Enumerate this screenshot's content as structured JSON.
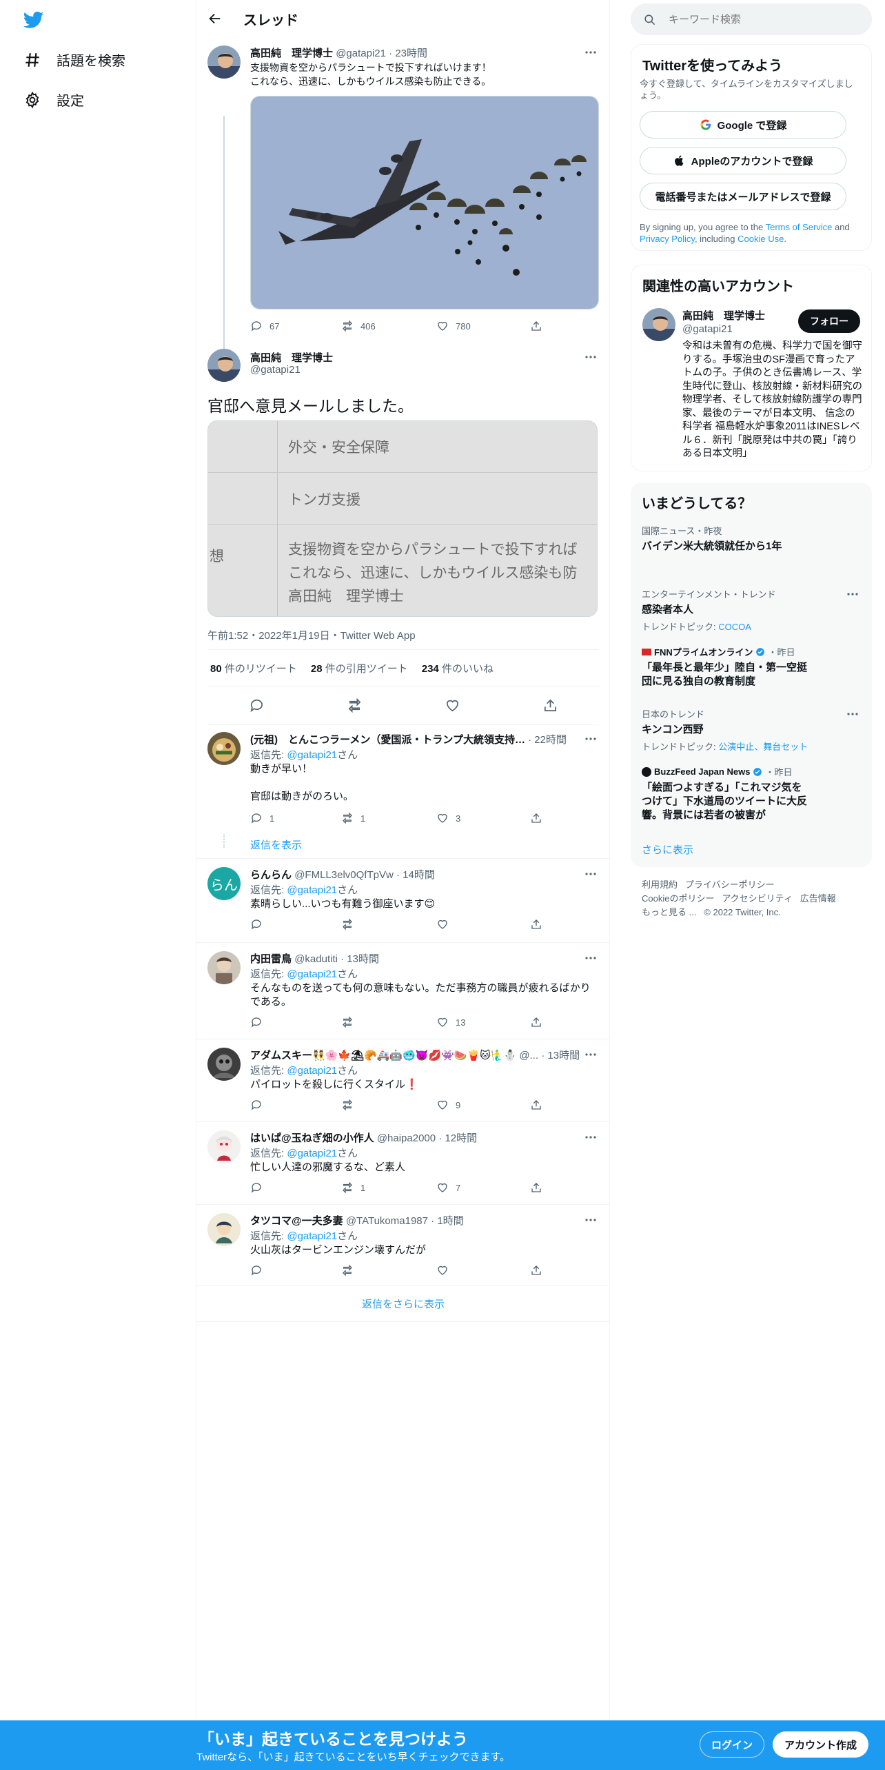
{
  "colors": {
    "accent": "#1d9bf0",
    "text": "#0f1419",
    "muted": "#536471",
    "border": "#eff3f4"
  },
  "nav": {
    "explore": "話題を検索",
    "settings": "設定"
  },
  "header": {
    "title": "スレッド"
  },
  "tweet1": {
    "name": "高田純　理学博士",
    "handle": "@gatapi21",
    "time": "23時間",
    "line1": "支援物資を空からパラシュートで投下すればいけます！",
    "line2": "これなら、迅速に、しかもウイルス感染も防止できる。",
    "replies": "67",
    "retweets": "406",
    "likes": "780"
  },
  "tweet2": {
    "name": "高田純　理学博士",
    "handle": "@gatapi21",
    "text": "官邸へ意見メールしました。",
    "media": {
      "row1": "外交・安全保障",
      "row2": "トンガ支援",
      "row3_label": "想",
      "row3_line1": "支援物資を空からパラシュートで投下すれば",
      "row3_line2": "これなら、迅速に、しかもウイルス感染も防",
      "row3_line3": "高田純　理学博士"
    },
    "timestamp": "午前1:52・2022年1月19日・Twitter Web App",
    "stats": {
      "retweets_count": "80",
      "retweets_label": "件のリツイート",
      "quotes_count": "28",
      "quotes_label": "件の引用ツイート",
      "likes_count": "234",
      "likes_label": "件のいいね"
    }
  },
  "reply_prefix": "返信先: ",
  "reply_to": "@gatapi21",
  "reply_suffix": "さん",
  "replies": [
    {
      "name": "(元祖)　とんこつラーメン（愛国派・トランプ大統領支持…",
      "handle": "",
      "time": "22時間",
      "line1": "動きが早い！",
      "line2": "官邸は動きがのろい。",
      "reply_count": "1",
      "retweet_count": "1",
      "like_count": "3",
      "show_replies": "返信を表示"
    },
    {
      "name": "らんらん",
      "handle": "@FMLL3elv0QfTpVw",
      "time": "14時間",
      "line1": "素晴らしい...いつも有難う御座います😊",
      "avatar_text": "らん"
    },
    {
      "name": "内田雷鳥",
      "handle": "@kadutiti",
      "time": "13時間",
      "line1": "そんなものを送っても何の意味もない。ただ事務方の職員が疲れるばかり",
      "line2": "である。",
      "like_count": "13"
    },
    {
      "name": "アダムスキー👯🌸🍁⛱🥐🚑🤖🥶👿💋👾🍉🍟🐱🧜‍♂️⛄",
      "handle": "@...",
      "time": "13時間",
      "line1": "パイロットを殺しに行くスタイル❗",
      "like_count": "9"
    },
    {
      "name": "はいぱ@玉ねぎ畑の小作人",
      "handle": "@haipa2000",
      "time": "12時間",
      "line1": "忙しい人達の邪魔するな、ど素人",
      "retweet_count": "1",
      "like_count": "7"
    },
    {
      "name": "タツコマ@一夫多妻",
      "handle": "@TATukoma1987",
      "time": "1時間",
      "line1": "火山灰はタービンエンジン壊すんだが"
    }
  ],
  "more_replies": "返信をさらに表示",
  "search": {
    "placeholder": "キーワード検索"
  },
  "signup_card": {
    "title": "Twitterを使ってみよう",
    "subtitle": "今すぐ登録して、タイムラインをカスタマイズしましょう。",
    "google": "Google で登録",
    "apple": "Appleのアカウントで登録",
    "phone": "電話番号またはメールアドレスで登録",
    "terms_pre": "By signing up, you agree to the ",
    "terms_link": "Terms of Service",
    "terms_mid": " and ",
    "privacy_link": "Privacy Policy",
    "terms_mid2": ", including ",
    "cookie_link": "Cookie Use",
    "terms_end": "."
  },
  "related_card": {
    "title": "関連性の高いアカウント",
    "name": "高田純　理学博士",
    "handle": "@gatapi21",
    "follow": "フォロー",
    "bio": "令和は未曽有の危機、科学力で国を御守りする。手塚治虫のSF漫画で育ったアトムの子。子供のとき伝書鳩レース、学生時代に登山、核放射線・新材料研究の物理学者、そして核放射線防護学の専門家、最後のテーマが日本文明、 信念の科学者 福島軽水炉事象2011はINESレベル６．新刊「脱原発は中共の罠」「誇りある日本文明」"
  },
  "trends": {
    "title": "いまどうしてる？",
    "items": [
      {
        "meta": "国際ニュース・昨夜",
        "title": "バイデン米大統領就任から1年"
      },
      {
        "meta": "エンターテインメント・トレンド",
        "title": "感染者本人",
        "sub_label": "トレンドトピック: ",
        "sub_topics": "COCOA"
      },
      {
        "meta": "FNNプライムオンライン",
        "meta_time": "・昨日",
        "title": "「最年長と最年少」陸自・第一空挺団に見る独自の教育制度"
      },
      {
        "meta": "日本のトレンド",
        "title": "キンコン西野",
        "sub_label": "トレンドトピック: ",
        "sub_topics": "公演中止、舞台セット"
      },
      {
        "meta": "BuzzFeed Japan News",
        "meta_time": "・昨日",
        "title": "「絵面つよすぎる」「これマジ気をつけて」下水道局のツイートに大反響。背景には若者の被害が"
      }
    ],
    "show_more": "さらに表示"
  },
  "footer": {
    "terms": "利用規約",
    "privacy": "プライバシーポリシー",
    "cookie": "Cookieのポリシー",
    "accessibility": "アクセシビリティ",
    "ads": "広告情報",
    "more": "もっと見る ...",
    "copyright": "© 2022 Twitter, Inc."
  },
  "bottom_bar": {
    "title": "「いま」起きていることを見つけよう",
    "subtitle": "Twitterなら、「いま」起きていることをいち早くチェックできます。",
    "login": "ログイン",
    "signup": "アカウント作成"
  }
}
